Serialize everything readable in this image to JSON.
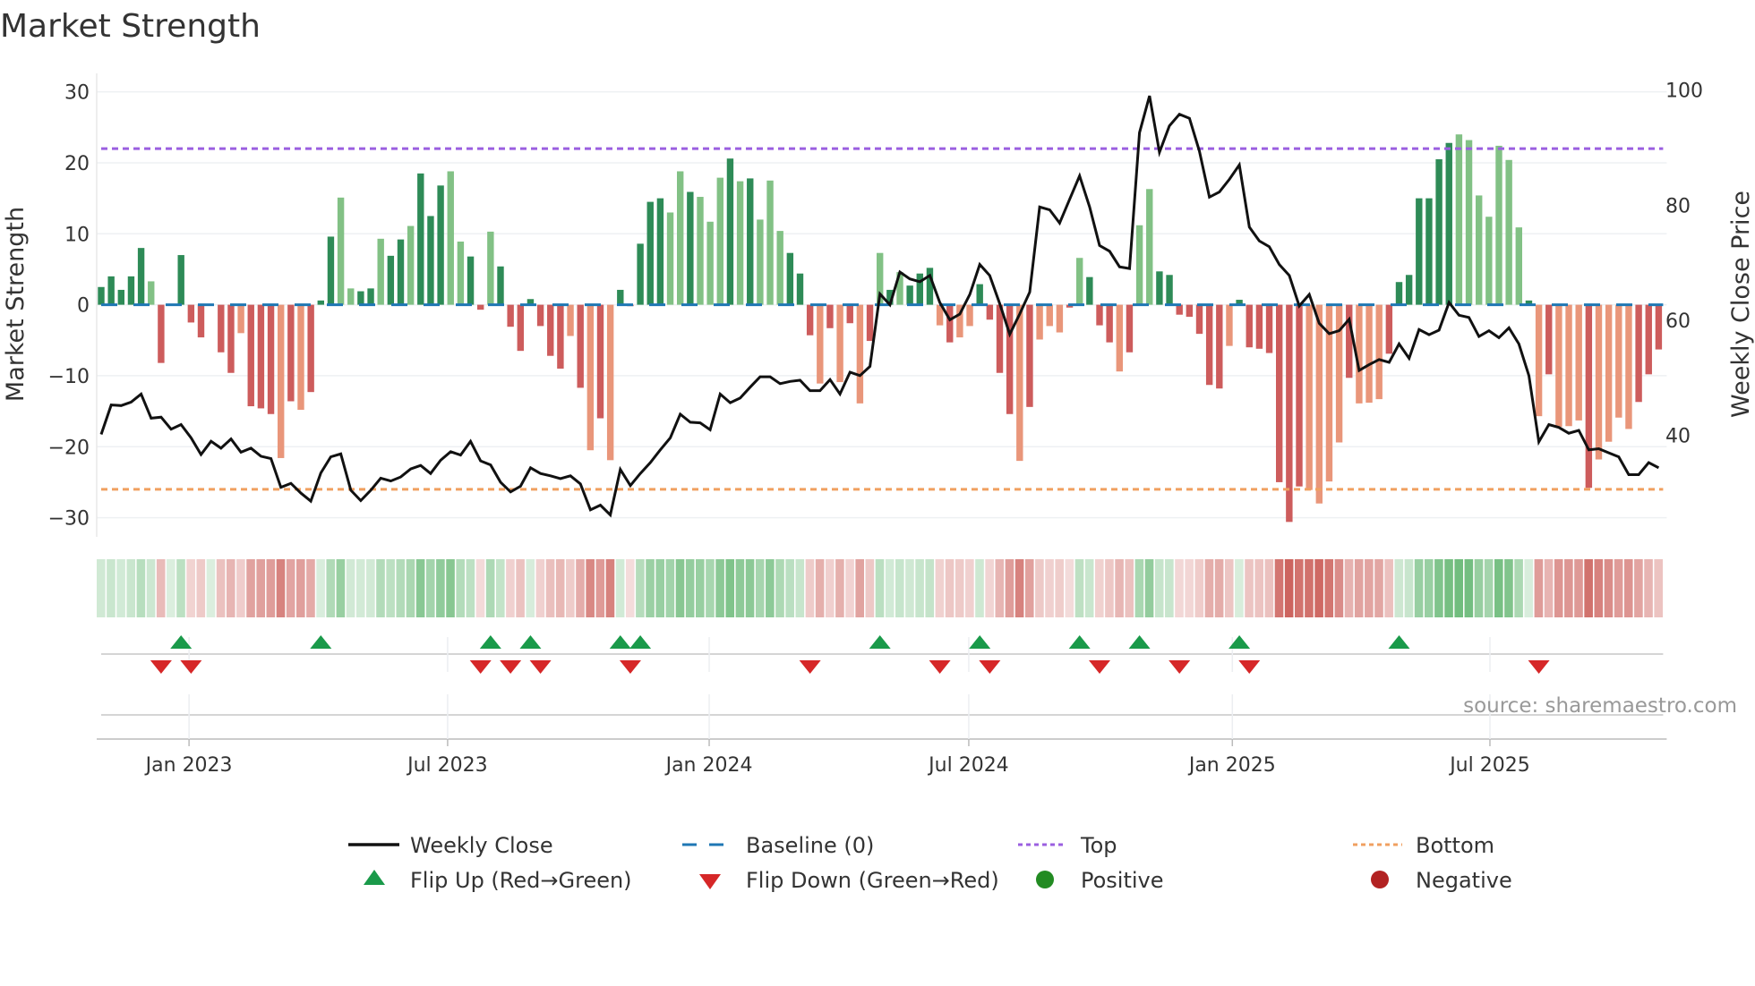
{
  "title": "Market Strength",
  "source": "source: sharemaestro.com",
  "colors": {
    "pos_strong": "#2e8b57",
    "pos_weak": "#82c185",
    "neg_strong": "#cd5c5c",
    "neg_weak": "#e9967a",
    "baseline": "#1f77b4",
    "top": "#9b5fe0",
    "bottom": "#f0a060",
    "price": "#111111",
    "flip_up": "#1a9a4a",
    "flip_down": "#d62728",
    "positive": "#228b22",
    "negative": "#b22222"
  },
  "legend": {
    "weekly_close": "Weekly Close",
    "baseline": "Baseline (0)",
    "top": "Top",
    "bottom": "Bottom",
    "flip_up": "Flip Up (Red→Green)",
    "flip_down": "Flip Down (Green→Red)",
    "positive": "Positive",
    "negative": "Negative"
  },
  "chart_data": {
    "type": "bar",
    "title": "Market Strength",
    "ylabel": "Market Strength",
    "y2label": "Weekly Close Price",
    "ylim": [
      -32.7,
      32.6
    ],
    "y2lim": [
      22.4,
      102.9
    ],
    "yticks": [
      "30",
      "20",
      "10",
      "0",
      "−10",
      "−20",
      "−30"
    ],
    "ytick_values": [
      30,
      20,
      10,
      0,
      -10,
      -20,
      -30
    ],
    "y2ticks": [
      "100",
      "80",
      "60",
      "40"
    ],
    "y2tick_values": [
      100,
      80,
      60,
      40
    ],
    "top_level": 22,
    "bottom_level": -26,
    "baseline_level": 0,
    "xticks": [
      {
        "label": "Jan 2023",
        "week": 8.8
      },
      {
        "label": "Jul 2023",
        "week": 34.7
      },
      {
        "label": "Jan 2024",
        "week": 60.9
      },
      {
        "label": "Jul 2024",
        "week": 86.9
      },
      {
        "label": "Jan 2025",
        "week": 113.3
      },
      {
        "label": "Jul 2025",
        "week": 139.1
      }
    ],
    "strength": [
      2.5,
      4,
      2.1,
      4,
      8,
      3.3,
      -8.2,
      0,
      7,
      -2.5,
      -4.6,
      0,
      -6.7,
      -9.6,
      -4,
      -14.3,
      -14.6,
      -15.4,
      -21.6,
      -13.6,
      -14.8,
      -12.3,
      0.6,
      9.6,
      15.1,
      2.3,
      1.9,
      2.3,
      9.3,
      6.9,
      9.2,
      11.1,
      18.5,
      12.5,
      16.8,
      18.8,
      8.9,
      6.8,
      -0.7,
      10.3,
      5.4,
      -3.1,
      -6.5,
      0.8,
      -3,
      -7.2,
      -9,
      -4.4,
      -11.7,
      -20.5,
      -16,
      -21.9,
      2.1,
      -0.2,
      8.6,
      14.5,
      15,
      13,
      18.8,
      15.9,
      15.2,
      11.7,
      17.9,
      20.6,
      17.4,
      17.8,
      12,
      17.5,
      10.4,
      7.3,
      4.4,
      -4.3,
      -11.1,
      -3.3,
      -10.9,
      -2.6,
      -13.9,
      -5.1,
      7.3,
      2.1,
      4.6,
      2.7,
      4.4,
      5.2,
      -2.9,
      -5.3,
      -4.6,
      -3,
      2.9,
      -2.1,
      -9.6,
      -15.4,
      -22,
      -14.4,
      -4.9,
      -3,
      -3.9,
      -0.4,
      6.6,
      3.9,
      -2.9,
      -5.3,
      -9.4,
      -6.7,
      11.2,
      16.3,
      4.7,
      4.2,
      -1.4,
      -1.7,
      -4.1,
      -11.3,
      -11.8,
      -5.8,
      0.7,
      -6,
      -6.2,
      -6.8,
      -25,
      -30.6,
      -25.6,
      -26.1,
      -28,
      -24.9,
      -19.4,
      -10.3,
      -13.9,
      -13.8,
      -13.3,
      -6.9,
      3.2,
      4.2,
      15,
      15,
      20.5,
      22.8,
      24,
      23.2,
      15.4,
      12.4,
      22.4,
      20.4,
      10.9,
      0.6,
      -15.7,
      -9.8,
      -17.2,
      -17.1,
      -16.3,
      -25.8,
      -21.8,
      -19.3,
      -15.9,
      -17.5,
      -13.7,
      -9.8,
      -6.3
    ],
    "shade": "dddddldxdddxddldddldldddllddlddldddllddldddddddldldldddddlldllldldllldddldldldldldddldllddddldllldldddldlldddddddldddddddlllldllldddddddllllllldldllldllll",
    "weekly_close": [
      40.2,
      45.3,
      45.2,
      45.8,
      47.2,
      43,
      43.2,
      41.1,
      41.9,
      39.6,
      36.7,
      39,
      37.8,
      39.4,
      37.1,
      37.8,
      36.4,
      36,
      31,
      31.7,
      30,
      28.6,
      33.5,
      36.3,
      36.8,
      30.5,
      28.7,
      30.5,
      32.6,
      32.1,
      32.8,
      34.2,
      34.8,
      33.4,
      35.7,
      37.2,
      36.6,
      39,
      35.6,
      34.9,
      31.9,
      30.2,
      31.2,
      34.4,
      33.4,
      33,
      32.5,
      33,
      31.6,
      27.1,
      27.9,
      26.2,
      34.1,
      31.3,
      33.4,
      35.3,
      37.5,
      39.6,
      43.7,
      42.3,
      42.2,
      41,
      47.2,
      45.7,
      46.5,
      48.4,
      50.2,
      50.2,
      49,
      49.4,
      49.6,
      47.8,
      47.8,
      49.7,
      47.2,
      51,
      50.4,
      52,
      64.6,
      62.7,
      68.4,
      67.2,
      66.7,
      67.8,
      63.1,
      60.1,
      61.1,
      64.5,
      69.7,
      67.8,
      62.9,
      57.6,
      61.1,
      64.9,
      79.7,
      79.2,
      76.9,
      81,
      85.1,
      79.7,
      73,
      72,
      69.3,
      69,
      92.6,
      99,
      89.2,
      93.8,
      95.8,
      95.1,
      89.4,
      81.4,
      82.3,
      84.5,
      87,
      76.2,
      73.8,
      72.8,
      69.7,
      67.8,
      62.5,
      64.5,
      59.5,
      57.7,
      58.2,
      60.2,
      51.3,
      52.3,
      53.2,
      52.7,
      55.9,
      53.4,
      58.4,
      57.5,
      58.3,
      63.1,
      60.9,
      60.5,
      57.2,
      58.2,
      57,
      58.7,
      55.9,
      50.4,
      38.9,
      41.9,
      41.4,
      40.4,
      40.9,
      37.5,
      37.7,
      37,
      36.3,
      33.2,
      33.2,
      35.3,
      34.4
    ],
    "flip_up_weeks": [
      8,
      22,
      39,
      43,
      52,
      54,
      78,
      88,
      98,
      104,
      114,
      130
    ],
    "flip_down_weeks": [
      6,
      9,
      38,
      41,
      44,
      53,
      71,
      84,
      89,
      100,
      108,
      115,
      144
    ]
  }
}
